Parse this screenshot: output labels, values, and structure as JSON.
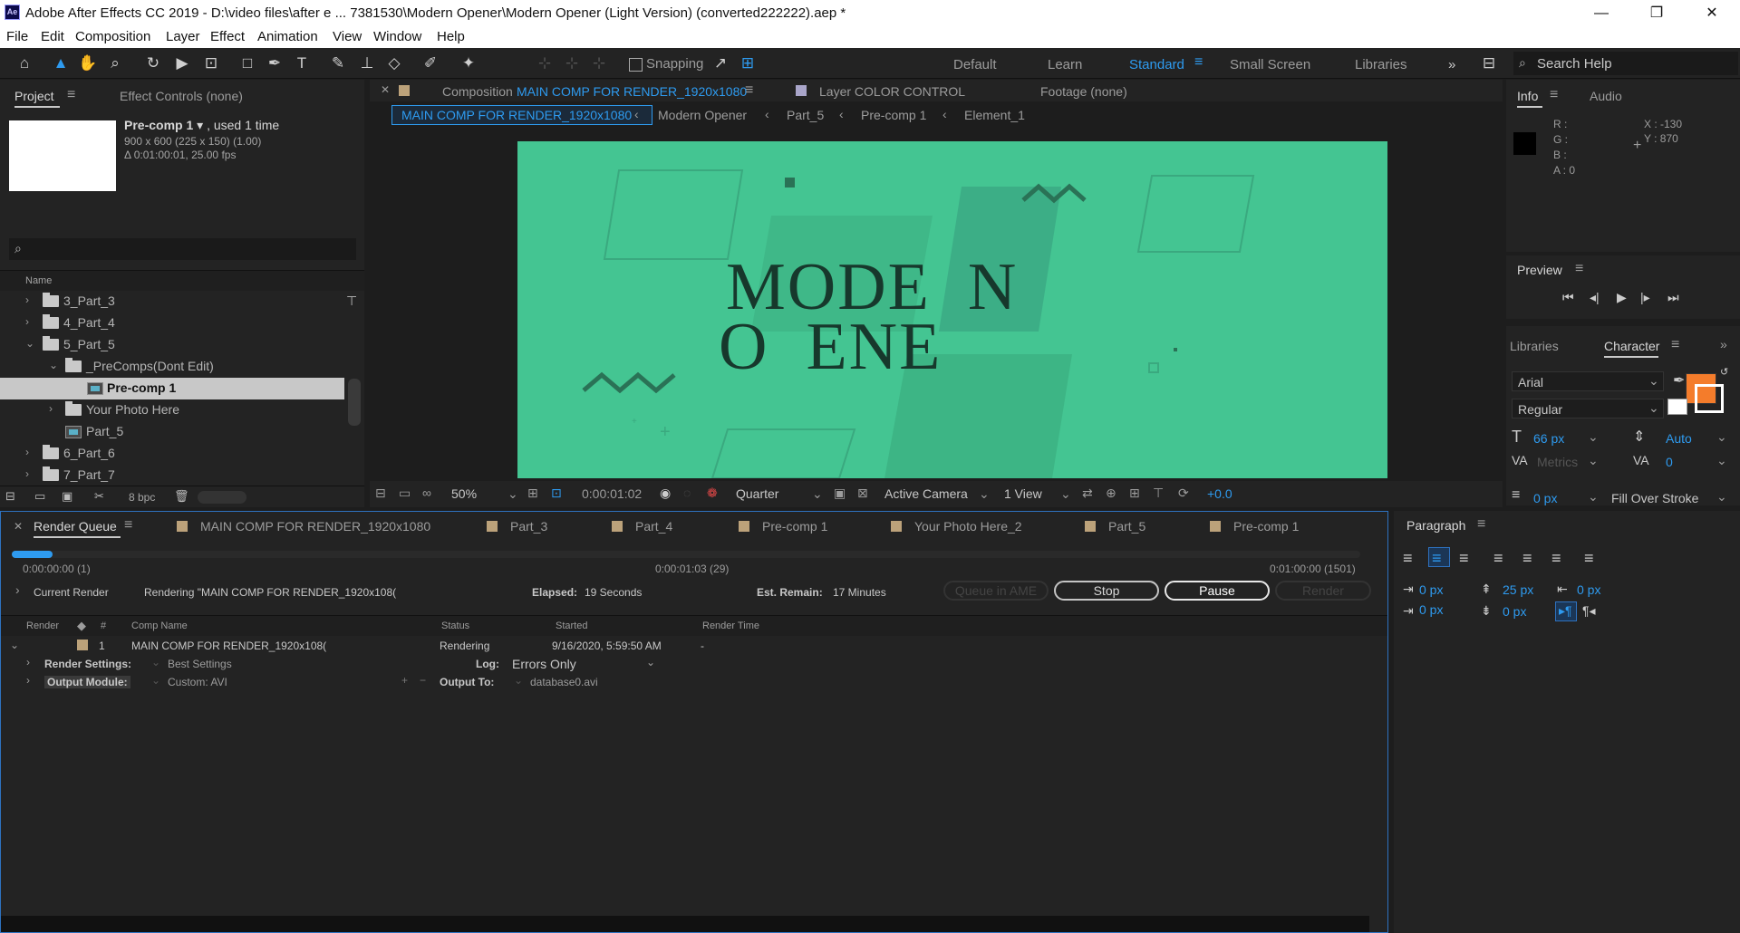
{
  "window": {
    "title": "Adobe After Effects CC 2019 - D:\\video files\\after e ... 7381530\\Modern Opener\\Modern Opener (Light Version) (converted222222).aep *",
    "app_icon": "Ae",
    "minimize": "—",
    "maximize": "❐",
    "close": "✕"
  },
  "menu": [
    "File",
    "Edit",
    "Composition",
    "Layer",
    "Effect",
    "Animation",
    "View",
    "Window",
    "Help"
  ],
  "toolbar": {
    "snapping": "Snapping",
    "workspaces": [
      "Default",
      "Learn",
      "Standard",
      "Small Screen",
      "Libraries"
    ],
    "active_workspace": "Standard",
    "search_placeholder": "Search Help"
  },
  "project_panel": {
    "tab_project": "Project",
    "tab_effect_controls": "Effect Controls (none)",
    "item_name": "Pre-comp 1",
    "item_used": ", used 1 time",
    "item_size": "900 x 600  (225 x 150) (1.00)",
    "item_duration": "Δ 0:01:00:01, 25.00 fps",
    "col_name": "Name",
    "tree": [
      {
        "label": "3_Part_3",
        "type": "folder",
        "expanded": false
      },
      {
        "label": "4_Part_4",
        "type": "folder",
        "expanded": false
      },
      {
        "label": "5_Part_5",
        "type": "folder",
        "expanded": true
      },
      {
        "label": "_PreComps(Dont Edit)",
        "type": "folder",
        "expanded": true
      },
      {
        "label": "Pre-comp 1",
        "type": "comp",
        "selected": true
      },
      {
        "label": "Your Photo Here",
        "type": "folder",
        "expanded": false
      },
      {
        "label": "Part_5",
        "type": "comp"
      },
      {
        "label": "6_Part_6",
        "type": "folder",
        "expanded": false
      },
      {
        "label": "7_Part_7",
        "type": "folder",
        "expanded": false
      }
    ],
    "bpc": "8 bpc"
  },
  "composition_panel": {
    "tab_prefix": "Composition",
    "tab_comp_name": "MAIN COMP FOR RENDER_1920x1080",
    "tab_layer": "Layer  COLOR CONTROL",
    "tab_footage": "Footage  (none)",
    "breadcrumbs": [
      "MAIN COMP FOR RENDER_1920x1080",
      "Modern Opener",
      "Part_5",
      "Pre-comp 1",
      "Element_1"
    ],
    "viewer_line1": "MODE  N",
    "viewer_line2": "O  ENE",
    "viewer_bg": "#44c592",
    "zoom": "50%",
    "timecode": "0:00:01:02",
    "resolution": "Quarter",
    "camera": "Active Camera",
    "views": "1 View",
    "exposure": "+0.0"
  },
  "info_panel": {
    "tab_info": "Info",
    "tab_audio": "Audio",
    "r": "R :",
    "g": "G :",
    "b": "B :",
    "a": "A :  0",
    "x": "X : -130",
    "y": "Y : 870"
  },
  "preview_panel": {
    "title": "Preview"
  },
  "character_panel": {
    "tab_libraries": "Libraries",
    "tab_character": "Character",
    "font": "Arial",
    "style": "Regular",
    "size": "66 px",
    "leading": "Auto",
    "kerning": "Metrics",
    "tracking": "0",
    "stroke": "0 px",
    "stroke_type": "Fill Over Stroke",
    "fill_color": "#f47c2b"
  },
  "render_queue": {
    "tab_render_queue": "Render Queue",
    "tabs": [
      "MAIN COMP FOR RENDER_1920x1080",
      "Part_3",
      "Part_4",
      "Pre-comp 1",
      "Your Photo Here_2",
      "Part_5",
      "Pre-comp 1"
    ],
    "progress": 0.03,
    "time_start": "0:00:00:00 (1)",
    "time_current": "0:00:01:03 (29)",
    "time_end": "0:01:00:00 (1501)",
    "current_render_label": "Current Render",
    "rendering_text": "Rendering \"MAIN COMP FOR RENDER_1920x108(",
    "elapsed_label": "Elapsed:",
    "elapsed_value": "19 Seconds",
    "remain_label": "Est. Remain:",
    "remain_value": "17 Minutes",
    "queue_ame": "Queue in AME",
    "stop": "Stop",
    "pause": "Pause",
    "render": "Render",
    "columns": [
      "Render",
      "#",
      "Comp Name",
      "Status",
      "Started",
      "Render Time"
    ],
    "item": {
      "number": "1",
      "comp_name": "MAIN COMP FOR RENDER_1920x108(",
      "status": "Rendering",
      "started": "9/16/2020, 5:59:50 AM",
      "render_time": "-"
    },
    "render_settings_label": "Render Settings:",
    "render_settings_value": "Best Settings",
    "log_label": "Log:",
    "log_value": "Errors Only",
    "output_module_label": "Output Module:",
    "output_module_value": "Custom: AVI",
    "output_to_label": "Output To:",
    "output_to_value": "database0.avi"
  },
  "paragraph_panel": {
    "title": "Paragraph",
    "indent_left": "0 px",
    "space_before": "25 px",
    "indent_right": "0 px",
    "first_indent": "0 px",
    "space_after": "0 px"
  }
}
